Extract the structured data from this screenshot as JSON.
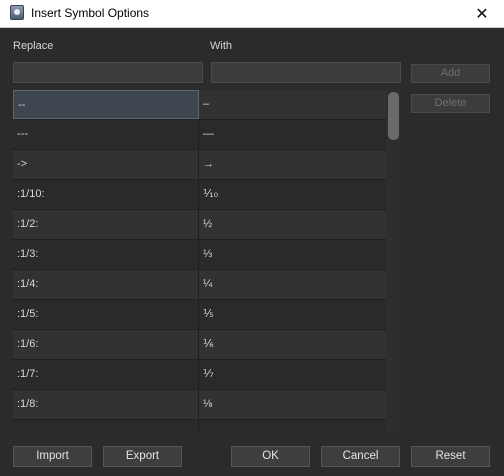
{
  "window": {
    "title": "Insert Symbol Options",
    "close_glyph": "✕"
  },
  "form": {
    "replace_label": "Replace",
    "with_label": "With",
    "replace_value": "",
    "with_value": "",
    "add_label": "Add",
    "delete_label": "Delete"
  },
  "table": {
    "selected_row": 0,
    "rows": [
      {
        "replace": "--",
        "with": "–"
      },
      {
        "replace": "---",
        "with": "—"
      },
      {
        "replace": "->",
        "with": "→"
      },
      {
        "replace": ":1/10:",
        "with": "⅒"
      },
      {
        "replace": ":1/2:",
        "with": "½"
      },
      {
        "replace": ":1/3:",
        "with": "⅓"
      },
      {
        "replace": ":1/4:",
        "with": "¼"
      },
      {
        "replace": ":1/5:",
        "with": "⅕"
      },
      {
        "replace": ":1/6:",
        "with": "⅙"
      },
      {
        "replace": ":1/7:",
        "with": "⅐"
      },
      {
        "replace": ":1/8:",
        "with": "⅛"
      },
      {
        "replace": "",
        "with": ""
      }
    ]
  },
  "footer": {
    "import_label": "Import",
    "export_label": "Export",
    "ok_label": "OK",
    "cancel_label": "Cancel",
    "reset_label": "Reset"
  },
  "colors": {
    "window_bg": "#2b2b2b",
    "selected_cell": "#3d464e",
    "titlebar_bg": "#ffffff"
  }
}
